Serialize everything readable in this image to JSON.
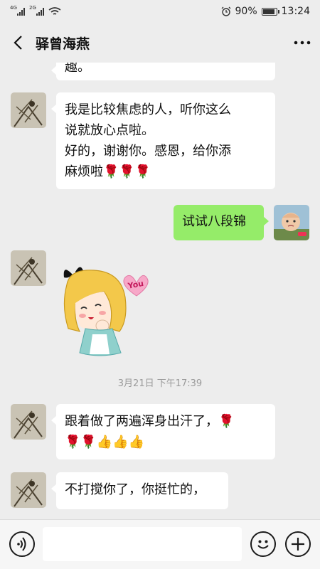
{
  "status_bar": {
    "network1": "4G",
    "network2": "2G",
    "battery": "90%",
    "time": "13:24"
  },
  "header": {
    "title": "驿曾海燕"
  },
  "messages": [
    {
      "from": "them",
      "lines": [
        "趣。"
      ]
    },
    {
      "from": "them",
      "lines": [
        "我是比较焦虑的人，听你这么",
        "说就放心点啦。",
        "好的，谢谢你。感恩，给你添",
        "麻烦啦🌹🌹🌹"
      ]
    },
    {
      "from": "me",
      "lines": [
        "试试八段锦"
      ]
    },
    {
      "from": "them",
      "sticker": "girl-you-sticker",
      "sticker_text": "You"
    },
    {
      "from": "them",
      "lines": [
        "跟着做了两遍浑身出汗了，🌹",
        "🌹🌹👍👍👍"
      ]
    },
    {
      "from": "them",
      "lines": [
        "不打搅你了，你挺忙的，"
      ]
    }
  ],
  "timestamp": "3月21日 下午17:39",
  "colors": {
    "background": "#ededed",
    "my_bubble": "#95ec69",
    "their_bubble": "#ffffff"
  },
  "input_bar": {
    "voice_icon": "voice-icon",
    "emoji_icon": "emoji-icon",
    "plus_icon": "plus-icon",
    "placeholder": ""
  }
}
